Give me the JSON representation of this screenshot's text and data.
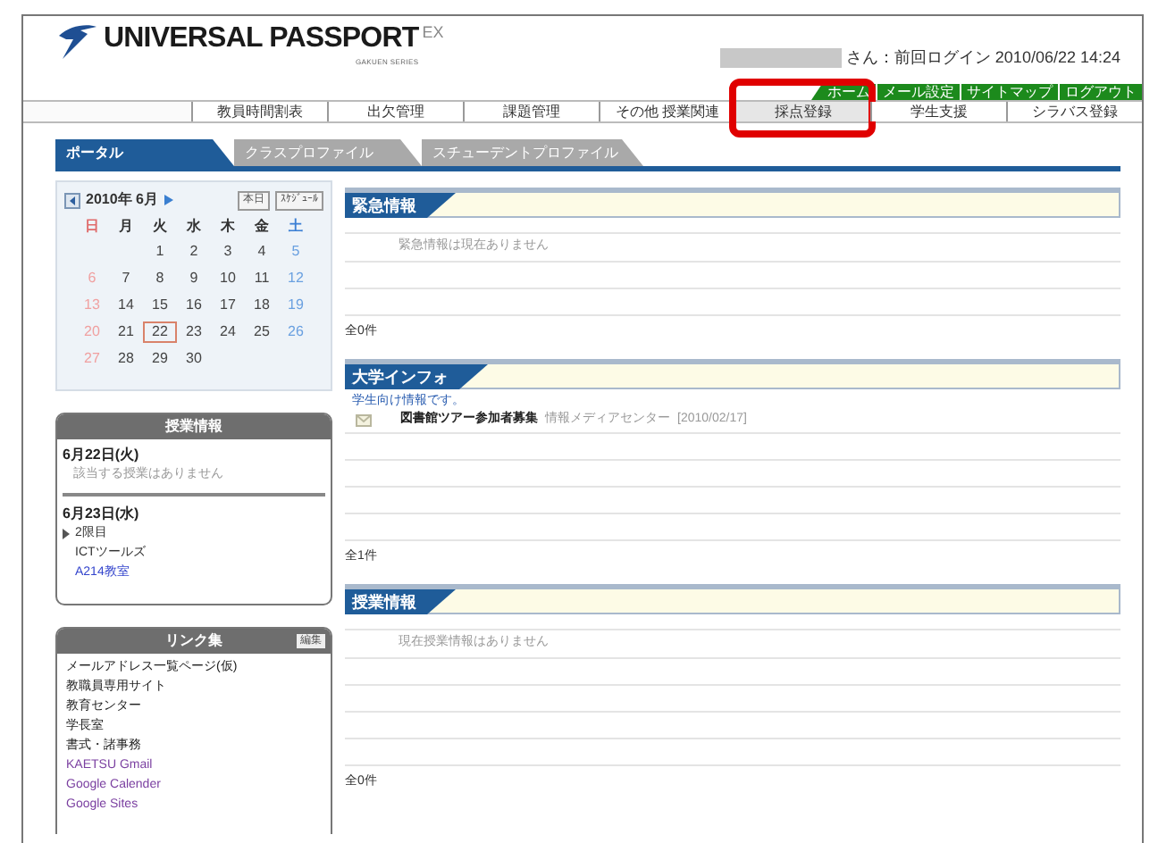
{
  "logo": {
    "name": "UNIVERSAL PASSPORT",
    "edition": "EX",
    "series": "GAKUEN SERIES"
  },
  "user": {
    "login_info": "さん：前回ログイン 2010/06/22 14:24"
  },
  "top_links": [
    "ホーム",
    "メール設定",
    "サイトマップ",
    "ログアウト"
  ],
  "menu": [
    {
      "label": "教員時間割表",
      "highlighted": false
    },
    {
      "label": "出欠管理",
      "highlighted": false
    },
    {
      "label": "課題管理",
      "highlighted": false
    },
    {
      "label": "その他 授業関連",
      "highlighted": false
    },
    {
      "label": "採点登録",
      "highlighted": true
    },
    {
      "label": "学生支援",
      "highlighted": false
    },
    {
      "label": "シラバス登録",
      "highlighted": false
    }
  ],
  "tabs": [
    {
      "label": "ポータル",
      "selected": true
    },
    {
      "label": "クラスプロファイル",
      "selected": false
    },
    {
      "label": "スチューデントプロファイル",
      "selected": false
    }
  ],
  "calendar": {
    "title": "2010年 6月",
    "buttons": [
      "本日",
      "ｽｹｼﾞｭｰﾙ"
    ],
    "weekdays": [
      "日",
      "月",
      "火",
      "水",
      "木",
      "金",
      "土"
    ],
    "weeks": [
      {
        "kind": "leading",
        "days": [
          {
            "d": "1",
            "selected": false
          },
          {
            "d": "2",
            "selected": false
          },
          {
            "d": "3",
            "selected": false
          },
          {
            "d": "4",
            "selected": false
          },
          {
            "d": "5",
            "selected": false
          }
        ]
      },
      {
        "kind": "full",
        "days": [
          {
            "d": "6",
            "selected": false
          },
          {
            "d": "7",
            "selected": false
          },
          {
            "d": "8",
            "selected": false
          },
          {
            "d": "9",
            "selected": false
          },
          {
            "d": "10",
            "selected": false
          },
          {
            "d": "11",
            "selected": false
          },
          {
            "d": "12",
            "selected": false
          }
        ]
      },
      {
        "kind": "full",
        "days": [
          {
            "d": "13",
            "selected": false
          },
          {
            "d": "14",
            "selected": false
          },
          {
            "d": "15",
            "selected": false
          },
          {
            "d": "16",
            "selected": false
          },
          {
            "d": "17",
            "selected": false
          },
          {
            "d": "18",
            "selected": false
          },
          {
            "d": "19",
            "selected": false
          }
        ]
      },
      {
        "kind": "full",
        "days": [
          {
            "d": "20",
            "selected": false
          },
          {
            "d": "21",
            "selected": false
          },
          {
            "d": "22",
            "selected": true
          },
          {
            "d": "23",
            "selected": false
          },
          {
            "d": "24",
            "selected": false
          },
          {
            "d": "25",
            "selected": false
          },
          {
            "d": "26",
            "selected": false
          }
        ]
      },
      {
        "kind": "trailing",
        "days": [
          {
            "d": "27",
            "selected": false
          },
          {
            "d": "28",
            "selected": false
          },
          {
            "d": "29",
            "selected": false
          },
          {
            "d": "30",
            "selected": false
          }
        ]
      }
    ]
  },
  "class_panel": {
    "title": "授業情報",
    "days": [
      {
        "date": "6月22日(火)",
        "lines": [
          {
            "kind": "note",
            "text": "該当する授業はありません"
          }
        ]
      },
      {
        "date": "6月23日(水)",
        "lines": [
          {
            "kind": "period",
            "text": "2限目"
          },
          {
            "kind": "plain",
            "text": "ICTツールズ"
          },
          {
            "kind": "link",
            "text": "A214教室"
          }
        ]
      }
    ]
  },
  "links_panel": {
    "title": "リンク集",
    "edit_button": "編集",
    "links": [
      {
        "label": "メールアドレス一覧ページ(仮)",
        "visited": false
      },
      {
        "label": "教職員専用サイト",
        "visited": false
      },
      {
        "label": "教育センター",
        "visited": false
      },
      {
        "label": "学長室",
        "visited": false
      },
      {
        "label": "書式・諸事務",
        "visited": false
      },
      {
        "label": "KAETSU Gmail",
        "visited": true
      },
      {
        "label": "Google Calender",
        "visited": true
      },
      {
        "label": "Google Sites",
        "visited": true
      }
    ]
  },
  "sections": [
    {
      "title": "緊急情報",
      "items": [
        {
          "kind": "message",
          "text": "緊急情報は現在ありません"
        }
      ],
      "count": "全0件"
    },
    {
      "title": "大学インフォ",
      "subtitle": "学生向け情報です。",
      "items": [
        {
          "kind": "news",
          "text": "図書館ツアー参加者募集",
          "source": "情報メディアセンター",
          "date": "[2010/02/17]"
        }
      ],
      "count": "全1件"
    },
    {
      "title": "授業情報",
      "items": [
        {
          "kind": "message",
          "text": "現在授業情報はありません"
        }
      ],
      "count": "全0件"
    }
  ]
}
